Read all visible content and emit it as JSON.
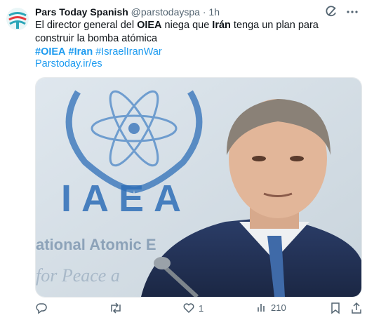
{
  "account": {
    "name": "Pars Today Spanish",
    "handle": "@parstodayspa",
    "separator": "·",
    "time": "1h"
  },
  "tweet": {
    "t1": "El director general del ",
    "t2": "OIEA",
    "t3": " niega que ",
    "t4": "Irán",
    "t5": " tenga un plan para construir la bomba atómica",
    "hashtags": [
      "#OIEA",
      "#Iran",
      "#IsraelIranWar"
    ],
    "link": "Parstoday.ir/es"
  },
  "media": {
    "sign_text": "IAEA",
    "sign_sub1": "ational Atomic E",
    "sign_sub2": "for Peace a"
  },
  "actions": {
    "reply_count": "",
    "retweet_count": "",
    "like_count": "1",
    "views_count": "210"
  },
  "icons": [
    "grok-icon",
    "more-icon",
    "reply-icon",
    "retweet-icon",
    "like-icon",
    "views-icon",
    "bookmark-icon",
    "share-icon"
  ],
  "colors": {
    "accent": "#1d9bf0",
    "muted": "#536471",
    "text": "#0f1419"
  }
}
